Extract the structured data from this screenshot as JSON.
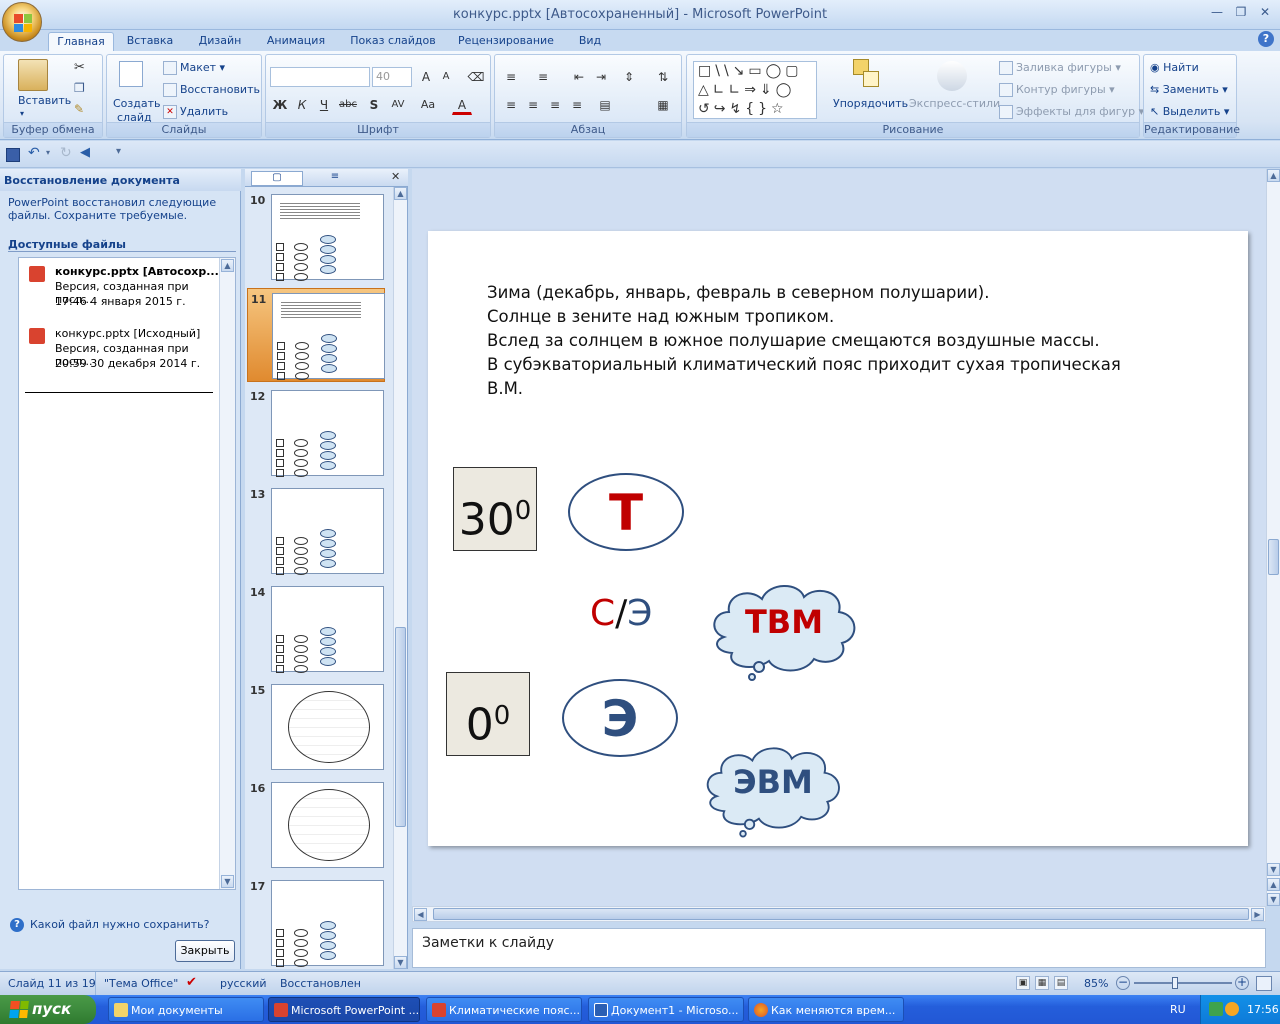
{
  "window": {
    "title": "конкурс.pptx [Автосохраненный] - Microsoft PowerPoint",
    "help": "?"
  },
  "tabs": [
    "Главная",
    "Вставка",
    "Дизайн",
    "Анимация",
    "Показ слайдов",
    "Рецензирование",
    "Вид"
  ],
  "ribbon": {
    "clipboard": {
      "label": "Буфер обмена",
      "paste": "Вставить"
    },
    "slides": {
      "label": "Слайды",
      "new_slide": "Создать",
      "new_slide2": "слайд",
      "layout": "Макет",
      "reset": "Восстановить",
      "delete": "Удалить"
    },
    "font": {
      "label": "Шрифт",
      "size": "40"
    },
    "paragraph": {
      "label": "Абзац"
    },
    "drawing": {
      "label": "Рисование",
      "arrange": "Упорядочить",
      "quick_styles": "Экспресс-стили",
      "fill": "Заливка фигуры",
      "outline": "Контур фигуры",
      "effects": "Эффекты для фигур"
    },
    "editing": {
      "label": "Редактирование",
      "find": "Найти",
      "replace": "Заменить",
      "select": "Выделить"
    }
  },
  "recovery": {
    "title": "Восстановление документа",
    "message": "PowerPoint восстановил следующие файлы. Сохраните требуемые.",
    "available": "Доступные файлы",
    "files": [
      {
        "name": "конкурс.pptx [Автосохр...",
        "desc": "Версия, созданная при посл...",
        "time": "17:46 4 января 2015 г."
      },
      {
        "name": "конкурс.pptx [Исходный]",
        "desc": "Версия, созданная при посл...",
        "time": "20:59 30 декабря 2014 г."
      }
    ],
    "question": "Какой файл нужно сохранить?",
    "close": "Закрыть"
  },
  "thumbnails": [
    "10",
    "11",
    "12",
    "13",
    "14",
    "15",
    "16",
    "17"
  ],
  "slide": {
    "lines": [
      "Зима (декабрь, январь, февраль в северном полушарии).",
      "Солнце в зените над южным тропиком.",
      "Вслед за солнцем в южное полушарие смещаются воздушные массы.",
      "В субэкваториальный климатический пояс приходит сухая тропическая",
      "В.М."
    ],
    "deg30": "30",
    "deg0": "0",
    "sup": "0",
    "t": "Т",
    "e": "Э",
    "c": "С",
    "slash": "/",
    "e2": "Э",
    "tvm": "ТВМ",
    "evm": "ЭВМ"
  },
  "notes": "Заметки к слайду",
  "status": {
    "slide": "Слайд 11 из 19",
    "theme": "\"Тема Office\"",
    "lang": "русский",
    "state": "Восстановлен",
    "zoom": "85%"
  },
  "taskbar": {
    "start": "пуск",
    "items": [
      "Мои документы",
      "Microsoft PowerPoint ...",
      "Климатические пояс...",
      "Документ1 - Microso...",
      "Как меняются врем..."
    ],
    "lang": "RU",
    "time": "17:56"
  }
}
